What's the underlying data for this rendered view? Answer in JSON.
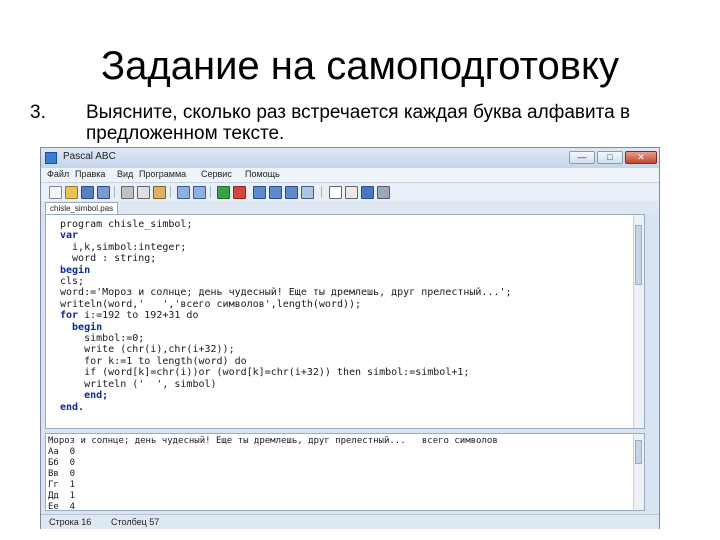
{
  "slide": {
    "title": "Задание на самоподготовку",
    "task_number": "3.",
    "task_text": "Выясните, сколько раз встречается каждая буква алфавита в предложенном тексте."
  },
  "window": {
    "title": "Pascal ABC",
    "controls": {
      "minimize": "—",
      "maximize": "□",
      "close": "✕"
    }
  },
  "menu": [
    "Файл",
    "Правка",
    "Вид",
    "Программа",
    "Сервис",
    "Помощь"
  ],
  "toolbar_icons": [
    "new-file-icon",
    "open-icon",
    "save-icon",
    "save-all-icon",
    "cut-icon",
    "copy-icon",
    "paste-icon",
    "undo-icon",
    "redo-icon",
    "run-icon",
    "stop-icon",
    "step-icon",
    "step-into-icon",
    "step-out-icon",
    "watch-icon",
    "font-icon",
    "format-icon",
    "help-icon",
    "settings-icon"
  ],
  "tab_label": "chisle_simbol.pas",
  "code_lines": [
    {
      "kw": "",
      "text": "program chisle_simbol;"
    },
    {
      "kw": "var",
      "text": ""
    },
    {
      "kw": "",
      "text": "  i,k,simbol:integer;"
    },
    {
      "kw": "",
      "text": "  word : string;"
    },
    {
      "kw": "begin",
      "text": ""
    },
    {
      "kw": "",
      "text": "cls;"
    },
    {
      "kw": "",
      "text": "word:='Мороз и солнце; день чудесный! Еще ты дремлешь, друг прелестный...';"
    },
    {
      "kw": "",
      "text": "writeln(word,'   ','всего символов',length(word));"
    },
    {
      "kw": "for",
      "text": " i:=192 to 192+31 do"
    },
    {
      "kw": "  begin",
      "text": ""
    },
    {
      "kw": "",
      "text": "    simbol:=0;"
    },
    {
      "kw": "",
      "text": "    write (chr(i),chr(i+32));"
    },
    {
      "kw": "",
      "text": "    for k:=1 to length(word) do"
    },
    {
      "kw": "",
      "text": "    if (word[k]=chr(i))or (word[k]=chr(i+32)) then simbol:=simbol+1;"
    },
    {
      "kw": "",
      "text": "    writeln ('  ', simbol)"
    },
    {
      "kw": "    end;",
      "text": ""
    },
    {
      "kw": "end.",
      "text": ""
    }
  ],
  "output_lines": [
    "Мороз и солнце; день чудесный! Еще ты дремлешь, друг прелестный...   всего символов",
    "Аа  0",
    "Бб  0",
    "Вв  0",
    "Гг  1",
    "Дд  1",
    "Ее  4"
  ],
  "status": {
    "line": "Строка 16",
    "column": "Столбец 57"
  }
}
